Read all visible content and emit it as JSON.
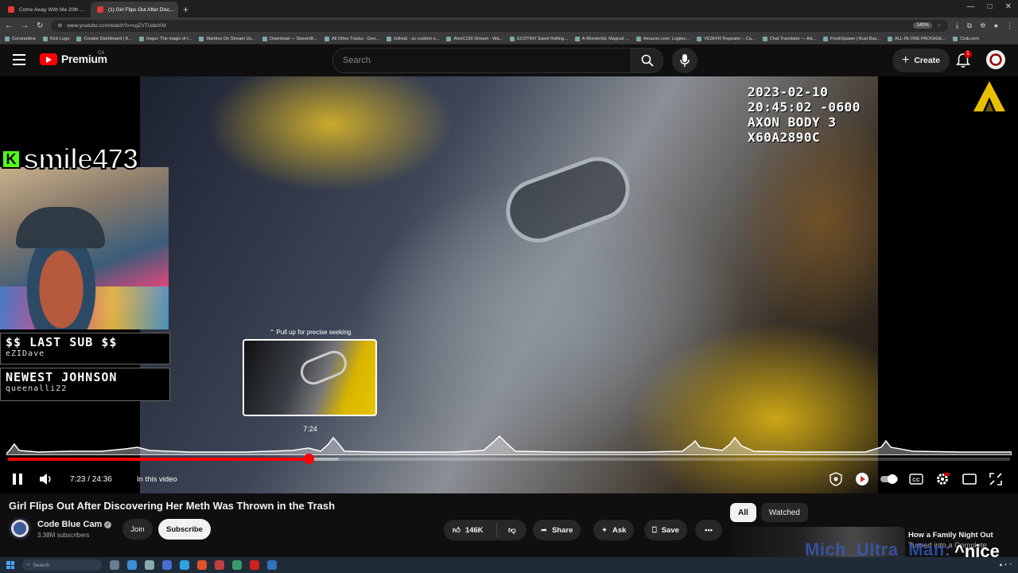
{
  "browser": {
    "tabs": [
      {
        "title": "Come Away With Me 20th ...",
        "active": false
      },
      {
        "title": "(1) Girl Flips Out After Disc...",
        "active": true
      }
    ],
    "url": "www.youtube.com/watch?v=cqZVTUdelXM",
    "zoom": "140%",
    "bookmarks": [
      "Constantine",
      "Kick Logo",
      "Creator Dashboard | K...",
      "Imgur: The magic of t...",
      "Marbles On Stream Us...",
      "Download — StreamB...",
      "All Other Tracks - Goo...",
      "GitHub - ac-custom-s...",
      "AlexC199 Stream - Wa...",
      "ECOTINY Easel Rolling...",
      "A Wonderful, Magical ...",
      "Amazon.com: Logitec...",
      "VE3KFR Repeater – Ca...",
      "Chat Translator — Ad...",
      "FreshSpawn | Rust Bas...",
      "ALL-IN-ONE PACKAGE...",
      "Club.com"
    ]
  },
  "header": {
    "logo_text": "Premium",
    "country": "CA",
    "search_placeholder": "Search",
    "create_label": "Create",
    "notification_count": "1"
  },
  "video": {
    "timestamp_line1": "2023-02-10 20:45:02 -0600",
    "timestamp_line2": "AXON BODY 3 X60A2890C",
    "seek_hint": "Pull up for precise seeking",
    "seek_time": "7:24",
    "current_time": "7:23",
    "duration": "24:36",
    "time_display": "7:23 / 24:36",
    "chapter_label": "In this video",
    "progress_fraction": 0.3,
    "buffer_fraction": 0.33
  },
  "stream_overlay": {
    "streamer_name": "smile473",
    "last_sub_title": "$$ LAST SUB $$",
    "last_sub_name": "eZIDave",
    "newest_title": "NEWEST JOHNSON",
    "newest_name": "queenalli22",
    "chat_overlay_name": "Mich_Ultra_Man:",
    "chat_overlay_msg": "^nice"
  },
  "info": {
    "title": "Girl Flips Out After Discovering Her Meth Was Thrown in the Trash",
    "channel": "Code Blue Cam",
    "subscribers": "3.38M subscribers",
    "join_label": "Join",
    "subscribe_label": "Subscribe",
    "likes": "146K",
    "share_label": "Share",
    "ask_label": "Ask",
    "save_label": "Save"
  },
  "sidebar": {
    "chips": [
      {
        "label": "All",
        "selected": true
      },
      {
        "label": "Watched",
        "selected": false
      }
    ],
    "rec_title_line1": "How a Family Night Out",
    "rec_title_line2": "Turned into a Complete"
  },
  "taskbar": {
    "search_placeholder": "Search"
  },
  "colors": {
    "youtube_red": "#ff0000",
    "kick_green": "#53fc18",
    "background": "#0f0f0f"
  }
}
